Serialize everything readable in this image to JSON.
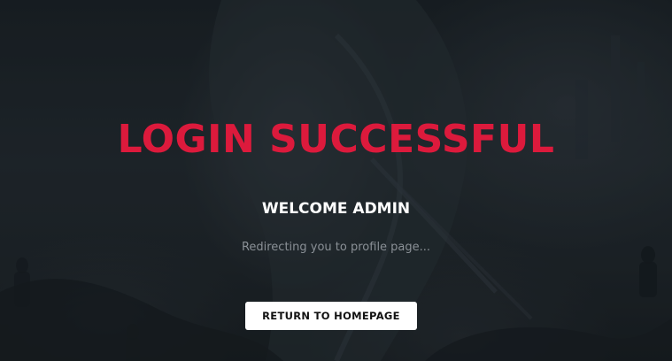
{
  "page": {
    "title": "LOGIN SUCCESSFUL",
    "welcome": "WELCOME ADMIN",
    "redirect_message": "Redirecting you to profile page...",
    "return_button_label": "RETURN TO HOMEPAGE"
  },
  "colors": {
    "title": "#dc1a3c",
    "background": "#1d2328",
    "button_bg": "#ffffff",
    "button_text": "#111111",
    "muted_text": "#8a9096"
  }
}
